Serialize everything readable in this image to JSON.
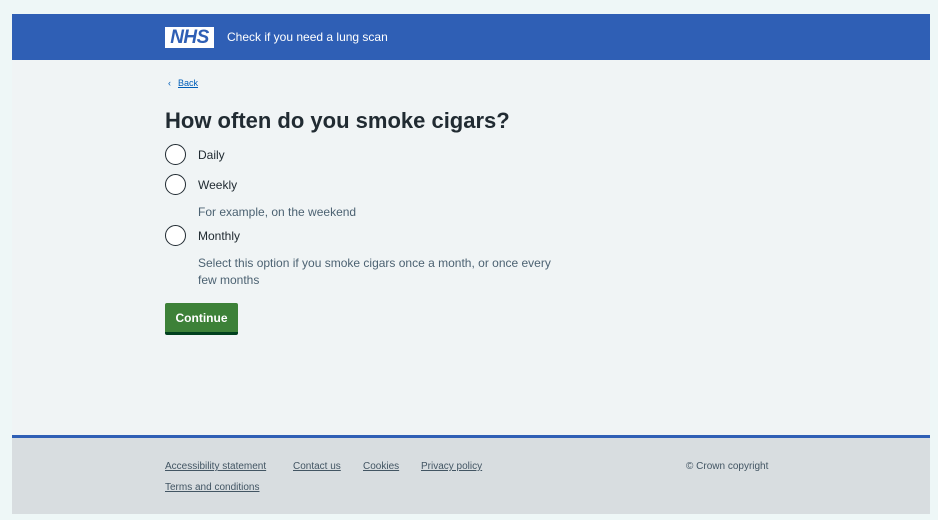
{
  "header": {
    "logo_text": "NHS",
    "service_name": "Check if you need a lung scan",
    "brand_color": "#2f5fb5"
  },
  "back": {
    "icon": "chevron-left-icon",
    "label": "Back"
  },
  "question": "How often do you smoke cigars?",
  "options": [
    {
      "label": "Daily",
      "hint": ""
    },
    {
      "label": "Weekly",
      "hint": "For example, on the weekend"
    },
    {
      "label": "Monthly",
      "hint": "Select this option if you smoke cigars once a month, or once every few months"
    }
  ],
  "continue_label": "Continue",
  "continue_color": "#3d8138",
  "footer": {
    "links": [
      "Accessibility statement",
      "Contact us",
      "Cookies",
      "Privacy policy",
      "Terms and conditions"
    ],
    "copyright": "© Crown copyright"
  }
}
